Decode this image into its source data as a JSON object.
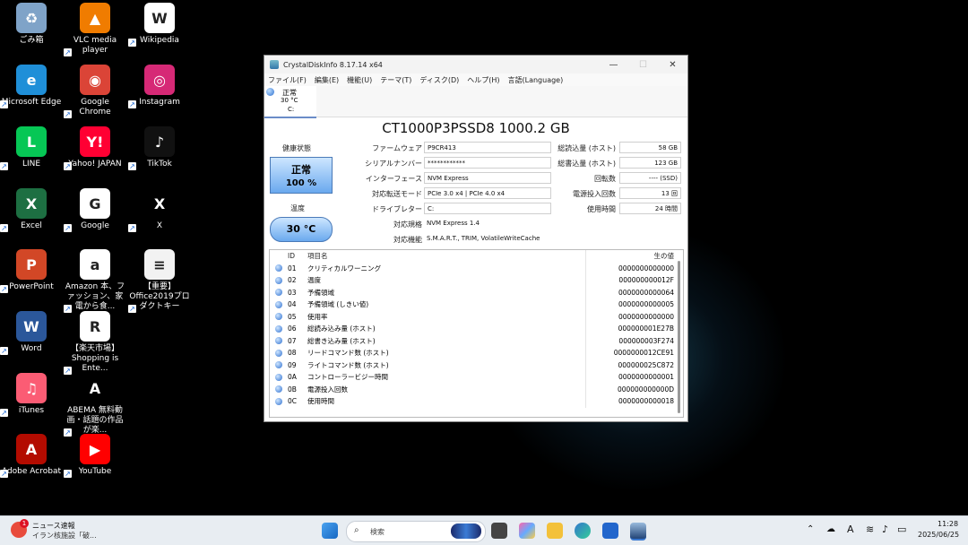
{
  "desktop": {
    "icons": [
      {
        "label": "ごみ箱",
        "color": "#7fa3c8",
        "glyph": "♻"
      },
      {
        "label": "VLC media player",
        "color": "#f07c00",
        "glyph": "▲"
      },
      {
        "label": "Wikipedia",
        "color": "#ffffff",
        "glyph": "W"
      },
      {
        "label": "Microsoft Edge",
        "color": "#1f8fd8",
        "glyph": "e"
      },
      {
        "label": "Google Chrome",
        "color": "#db4437",
        "glyph": "◉"
      },
      {
        "label": "Instagram",
        "color": "#d62976",
        "glyph": "◎"
      },
      {
        "label": "LINE",
        "color": "#06c755",
        "glyph": "L"
      },
      {
        "label": "Yahoo! JAPAN",
        "color": "#ff0033",
        "glyph": "Y!"
      },
      {
        "label": "TikTok",
        "color": "#111111",
        "glyph": "♪"
      },
      {
        "label": "Excel",
        "color": "#1d6f42",
        "glyph": "X"
      },
      {
        "label": "Google",
        "color": "#ffffff",
        "glyph": "G"
      },
      {
        "label": "X",
        "color": "#000000",
        "glyph": "X"
      },
      {
        "label": "PowerPoint",
        "color": "#d24726",
        "glyph": "P"
      },
      {
        "label": "Amazon 本、ファッション、家電から食...",
        "color": "#ffffff",
        "glyph": "a"
      },
      {
        "label": "【重要】Office2019プロダクトキー",
        "color": "#f2f2f2",
        "glyph": "≡"
      },
      {
        "label": "Word",
        "color": "#2b579a",
        "glyph": "W"
      },
      {
        "label": "【楽天市場】Shopping is Ente...",
        "color": "#ffffff",
        "glyph": "R"
      },
      {
        "label": "iTunes",
        "color": "#fb5c74",
        "glyph": "♫"
      },
      {
        "label": "ABEMA 無料動画・話題の作品が楽...",
        "color": "#000000",
        "glyph": "A"
      },
      {
        "label": "Adobe Acrobat",
        "color": "#b30b00",
        "glyph": "A"
      },
      {
        "label": "YouTube",
        "color": "#ff0000",
        "glyph": "▶"
      }
    ]
  },
  "window": {
    "title": "CrystalDiskInfo 8.17.14 x64",
    "controls": {
      "minimize": "—",
      "maximize": "☐",
      "close": "✕"
    },
    "menu": [
      "ファイル(F)",
      "編集(E)",
      "機能(U)",
      "テーマ(T)",
      "ディスク(D)",
      "ヘルプ(H)",
      "言語(Language)"
    ],
    "drive_tab": {
      "status": "正常",
      "temp": "30 °C",
      "letter": "C:"
    },
    "model": "CT1000P3PSSD8 1000.2 GB",
    "health_label": "健康状態",
    "health_status": "正常",
    "health_percent": "100 %",
    "temp_label": "温度",
    "temp_value": "30 °C",
    "info": [
      {
        "key": "ファームウェア",
        "value": "P9CR413"
      },
      {
        "key": "シリアルナンバー",
        "value": "************"
      },
      {
        "key": "インターフェース",
        "value": "NVM Express"
      },
      {
        "key": "対応転送モード",
        "value": "PCIe 3.0 x4 | PCIe 4.0 x4"
      },
      {
        "key": "ドライブレター",
        "value": "C:"
      },
      {
        "key": "対応規格",
        "value": "NVM Express 1.4"
      },
      {
        "key": "対応機能",
        "value": "S.M.A.R.T., TRIM, VolatileWriteCache"
      }
    ],
    "right_info": [
      {
        "key": "総読込量 (ホスト)",
        "value": "58 GB"
      },
      {
        "key": "総書込量 (ホスト)",
        "value": "123 GB"
      },
      {
        "key": "回転数",
        "value": "---- (SSD)"
      },
      {
        "key": "電源投入回数",
        "value": "13 回"
      },
      {
        "key": "使用時間",
        "value": "24 時間"
      }
    ],
    "smart_headers": {
      "id": "ID",
      "name": "項目名",
      "raw": "生の値"
    },
    "smart_rows": [
      {
        "id": "01",
        "name": "クリティカルワーニング",
        "raw": "0000000000000"
      },
      {
        "id": "02",
        "name": "温度",
        "raw": "000000000012F"
      },
      {
        "id": "03",
        "name": "予備領域",
        "raw": "0000000000064"
      },
      {
        "id": "04",
        "name": "予備領域 (しきい値)",
        "raw": "0000000000005"
      },
      {
        "id": "05",
        "name": "使用率",
        "raw": "0000000000000"
      },
      {
        "id": "06",
        "name": "総読み込み量 (ホスト)",
        "raw": "000000001E27B"
      },
      {
        "id": "07",
        "name": "総書き込み量 (ホスト)",
        "raw": "000000003F274"
      },
      {
        "id": "08",
        "name": "リードコマンド数 (ホスト)",
        "raw": "0000000012CE91"
      },
      {
        "id": "09",
        "name": "ライトコマンド数 (ホスト)",
        "raw": "000000025C872"
      },
      {
        "id": "0A",
        "name": "コントローラービジー時間",
        "raw": "0000000000001"
      },
      {
        "id": "0B",
        "name": "電源投入回数",
        "raw": "000000000000D"
      },
      {
        "id": "0C",
        "name": "使用時間",
        "raw": "0000000000018"
      }
    ]
  },
  "taskbar": {
    "news_title": "ニュース速報",
    "news_sub": "イラン核施設「破...",
    "news_badge": "1",
    "search_placeholder": "検索",
    "time": "11:28",
    "date": "2025/06/25",
    "ime": "A"
  }
}
